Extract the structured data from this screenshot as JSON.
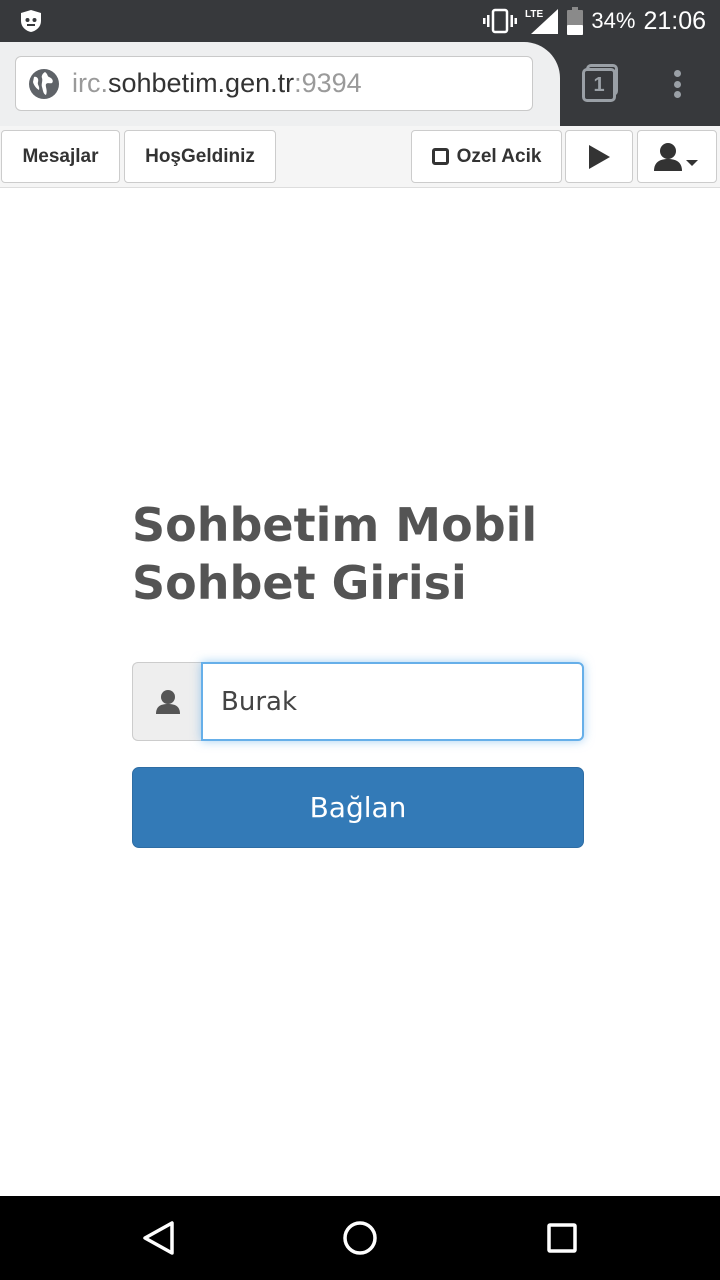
{
  "status_bar": {
    "battery_percent": "34%",
    "time": "21:06",
    "network": "LTE",
    "icons": [
      "app-shield-icon",
      "vibrate-icon",
      "lte-signal-icon",
      "battery-icon"
    ]
  },
  "browser": {
    "url_prefix": "irc.",
    "url_domain": "sohbetim.gen.tr",
    "url_port": ":9394",
    "tab_count": "1"
  },
  "toolbar": {
    "messages_label": "Mesajlar",
    "welcome_label": "HoşGeldiniz",
    "private_label": "Ozel Acik"
  },
  "login": {
    "title_line1": "Sohbetim Mobil",
    "title_line2": "Sohbet Girisi",
    "nickname_value": "Burak",
    "connect_label": "Bağlan"
  },
  "colors": {
    "primary_button": "#337ab7",
    "input_focus": "#66afe9",
    "status_bar": "#37393c"
  }
}
